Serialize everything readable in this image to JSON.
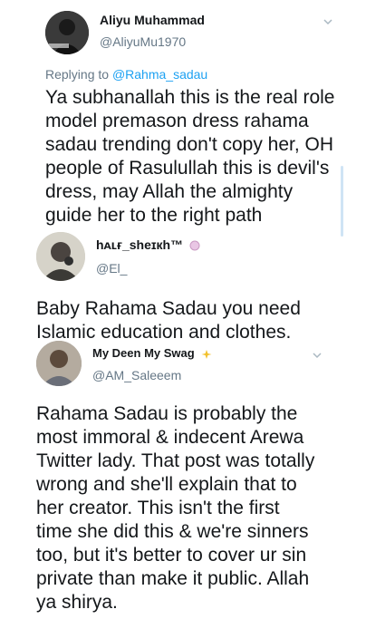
{
  "tweets": [
    {
      "display_name": "Aliyu Muhammad",
      "handle": "@AliyuMu1970",
      "replying_prefix": "Replying to ",
      "replying_to": "@Rahma_sadau",
      "text": "Ya subhanallah this is the real role model premason dress rahama sadau trending don't copy her, OH people of Rasulullah this is devil's dress, may Allah the almighty guide her to the right path",
      "lines": [
        "Ya subhanallah this is the real role",
        "model premason dress rahama",
        "sadau trending don't copy her, OH",
        "people of Rasulullah this is devil's",
        "dress, may Allah the almighty",
        "guide her to the right path"
      ]
    },
    {
      "display_name": "hᴀʟғ_sheɪкh™",
      "handle": "@El_",
      "badge_icon": "emoji-icon",
      "lines": [
        "Baby Rahama Sadau you need",
        "Islamic education and clothes."
      ]
    },
    {
      "display_name": "My Deen My Swag",
      "handle": "@AM_Saleeem",
      "badge_icon": "sparkle-emoji-icon",
      "lines": [
        "Rahama Sadau is probably the",
        "most immoral & indecent Arewa",
        "Twitter lady. That post was totally",
        "wrong and she'll explain that to",
        "her creator. This isn't the first",
        "time she did this & we're sinners",
        "too, but it's better to cover ur sin",
        "private than make it public. Allah",
        "ya shirya."
      ]
    }
  ],
  "colors": {
    "text": "#14171a",
    "secondary": "#657786",
    "link": "#1da1f2",
    "chevron": "#aab8c2"
  }
}
